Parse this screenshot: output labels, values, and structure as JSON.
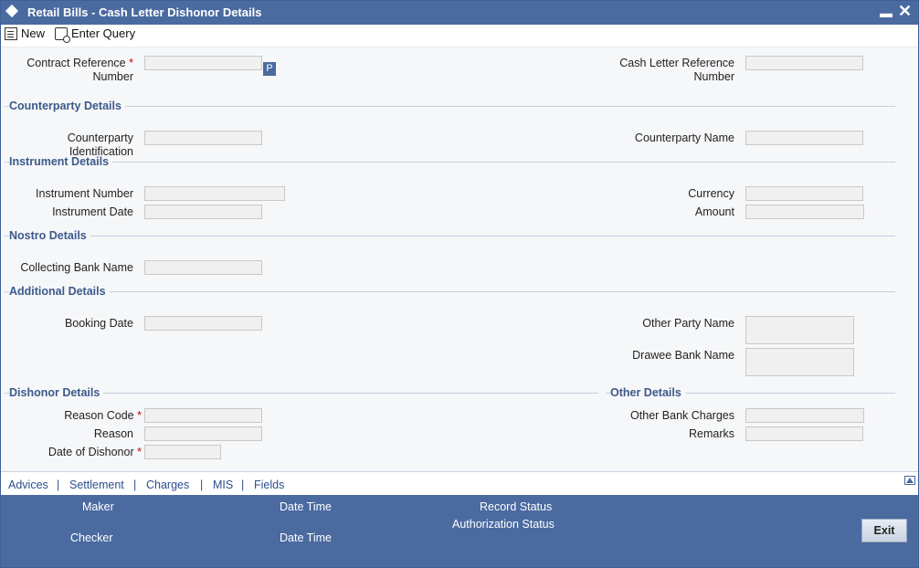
{
  "window": {
    "title": "Retail Bills - Cash Letter Dishonor Details"
  },
  "toolbar": {
    "new_label": "New",
    "enter_query_label": "Enter Query"
  },
  "fields": {
    "contract_ref_line1": "Contract Reference",
    "contract_ref_line2": "Number",
    "p_button": "P",
    "cash_letter_ref_line1": "Cash Letter Reference",
    "cash_letter_ref_line2": "Number",
    "counterparty_identification": "Counterparty Identification",
    "counterparty_name": "Counterparty Name",
    "instrument_number": "Instrument Number",
    "instrument_date": "Instrument Date",
    "currency": "Currency",
    "amount": "Amount",
    "collecting_bank_name": "Collecting Bank Name",
    "booking_date": "Booking Date",
    "other_party_name": "Other Party Name",
    "drawee_bank_name": "Drawee Bank Name",
    "reason_code": "Reason Code",
    "reason": "Reason",
    "date_of_dishonor": "Date of Dishonor",
    "other_bank_charges": "Other Bank Charges",
    "remarks": "Remarks",
    "required_mark": "*"
  },
  "sections": {
    "counterparty": "Counterparty Details",
    "instrument": "Instrument Details",
    "nostro": "Nostro Details",
    "additional": "Additional Details",
    "dishonor": "Dishonor Details",
    "other": "Other Details"
  },
  "tabs": {
    "advices": "Advices",
    "settlement": "Settlement",
    "charges": "Charges",
    "mis": "MIS",
    "fields": "Fields",
    "separator": "|"
  },
  "footer": {
    "maker": "Maker",
    "checker": "Checker",
    "date_time": "Date Time",
    "record_status": "Record Status",
    "authorization_status": "Authorization Status",
    "exit": "Exit"
  },
  "colors": {
    "title_bar": "#4a6aa0",
    "section_heading": "#3b5a8a",
    "required": "#cc0000"
  }
}
